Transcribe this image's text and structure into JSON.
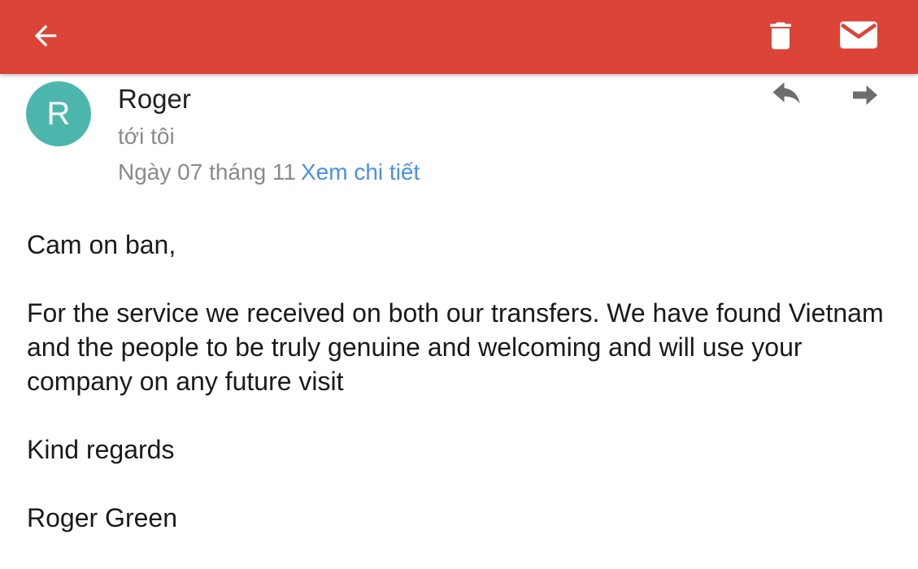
{
  "header": {
    "icons": [
      "back-arrow-icon",
      "trash-icon",
      "mail-icon"
    ],
    "color": "#db4437"
  },
  "message": {
    "avatar_letter": "R",
    "avatar_color": "#4db6ac",
    "sender": "Roger",
    "recipient": "tới tôi",
    "date": "Ngày 07 tháng 11",
    "details_link": "Xem chi tiết",
    "actions": [
      "reply-icon",
      "forward-icon"
    ]
  },
  "body": {
    "greeting": "Cam on ban,",
    "paragraph_1": "For the service we received on both our transfers. We have found Vietnam and the people to be truly genuine and welcoming and will use your company on any future visit",
    "closing": "Kind regards",
    "signature": "Roger Green"
  }
}
